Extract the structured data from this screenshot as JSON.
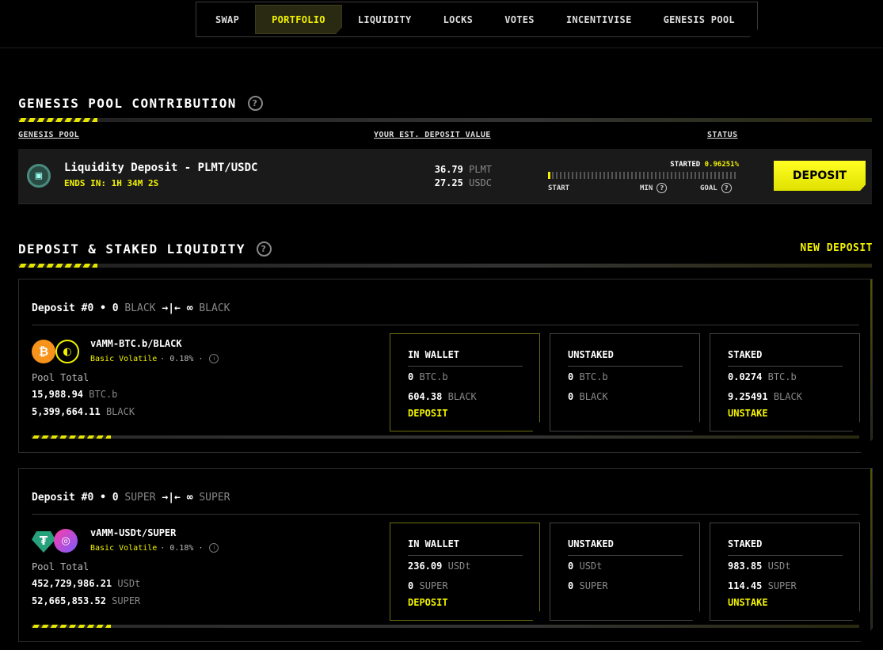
{
  "nav": {
    "items": [
      "SWAP",
      "PORTFOLIO",
      "LIQUIDITY",
      "LOCKS",
      "VOTES",
      "INCENTIVISE",
      "GENESIS POOL"
    ],
    "active": "PORTFOLIO"
  },
  "genesis": {
    "title": "GENESIS POOL CONTRIBUTION",
    "columns": {
      "pool": "GENESIS POOL",
      "value": "YOUR EST. DEPOSIT VALUE",
      "status": "STATUS"
    },
    "row": {
      "name": "Liquidity Deposit - PLMT/USDC",
      "ends": "ENDS IN:  1H 34M 2S",
      "amount1": "36.79",
      "unit1": "PLMT",
      "amount2": "27.25",
      "unit2": "USDC",
      "started_label": "STARTED",
      "started_pct": "0.96251%",
      "progress_fraction": 0.0096251,
      "start_label": "START",
      "min_label": "MIN",
      "goal_label": "GOAL",
      "button": "DEPOSIT"
    }
  },
  "deposits": {
    "title": "DEPOSIT & STAKED LIQUIDITY",
    "new_deposit": "NEW DEPOSIT",
    "cards": [
      {
        "head_a": "Deposit #0 • 0",
        "head_token": "BLACK",
        "head_b": "∞",
        "head_token2": "BLACK",
        "pair": "vAMM-BTC.b/BLACK",
        "type": "Basic Volatile",
        "fee": "· 0.18% ·",
        "pool_total_label": "Pool Total",
        "total1": "15,988.94",
        "total1_unit": "BTC.b",
        "total2": "5,399,664.11",
        "total2_unit": "BLACK",
        "wallet": {
          "title": "IN WALLET",
          "v1": "0",
          "u1": "BTC.b",
          "v2": "604.38",
          "u2": "BLACK",
          "action": "DEPOSIT"
        },
        "unstaked": {
          "title": "UNSTAKED",
          "v1": "0",
          "u1": "BTC.b",
          "v2": "0",
          "u2": "BLACK"
        },
        "staked": {
          "title": "STAKED",
          "v1": "0.0274",
          "u1": "BTC.b",
          "v2": "9.25491",
          "u2": "BLACK",
          "action": "UNSTAKE"
        }
      },
      {
        "head_a": "Deposit #0 • 0",
        "head_token": "SUPER",
        "head_b": "∞",
        "head_token2": "SUPER",
        "pair": "vAMM-USDt/SUPER",
        "type": "Basic Volatile",
        "fee": "· 0.18% ·",
        "pool_total_label": "Pool Total",
        "total1": "452,729,986.21",
        "total1_unit": "USDt",
        "total2": "52,665,853.52",
        "total2_unit": "SUPER",
        "wallet": {
          "title": "IN WALLET",
          "v1": "236.09",
          "u1": "USDt",
          "v2": "0",
          "u2": "SUPER",
          "action": "DEPOSIT"
        },
        "unstaked": {
          "title": "UNSTAKED",
          "v1": "0",
          "u1": "USDt",
          "v2": "0",
          "u2": "SUPER"
        },
        "staked": {
          "title": "STAKED",
          "v1": "983.85",
          "u1": "USDt",
          "v2": "114.45",
          "u2": "SUPER",
          "action": "UNSTAKE"
        }
      }
    ]
  },
  "colors": {
    "accent": "#f2f200",
    "bg": "#000000",
    "panel": "#1a1a1a"
  }
}
